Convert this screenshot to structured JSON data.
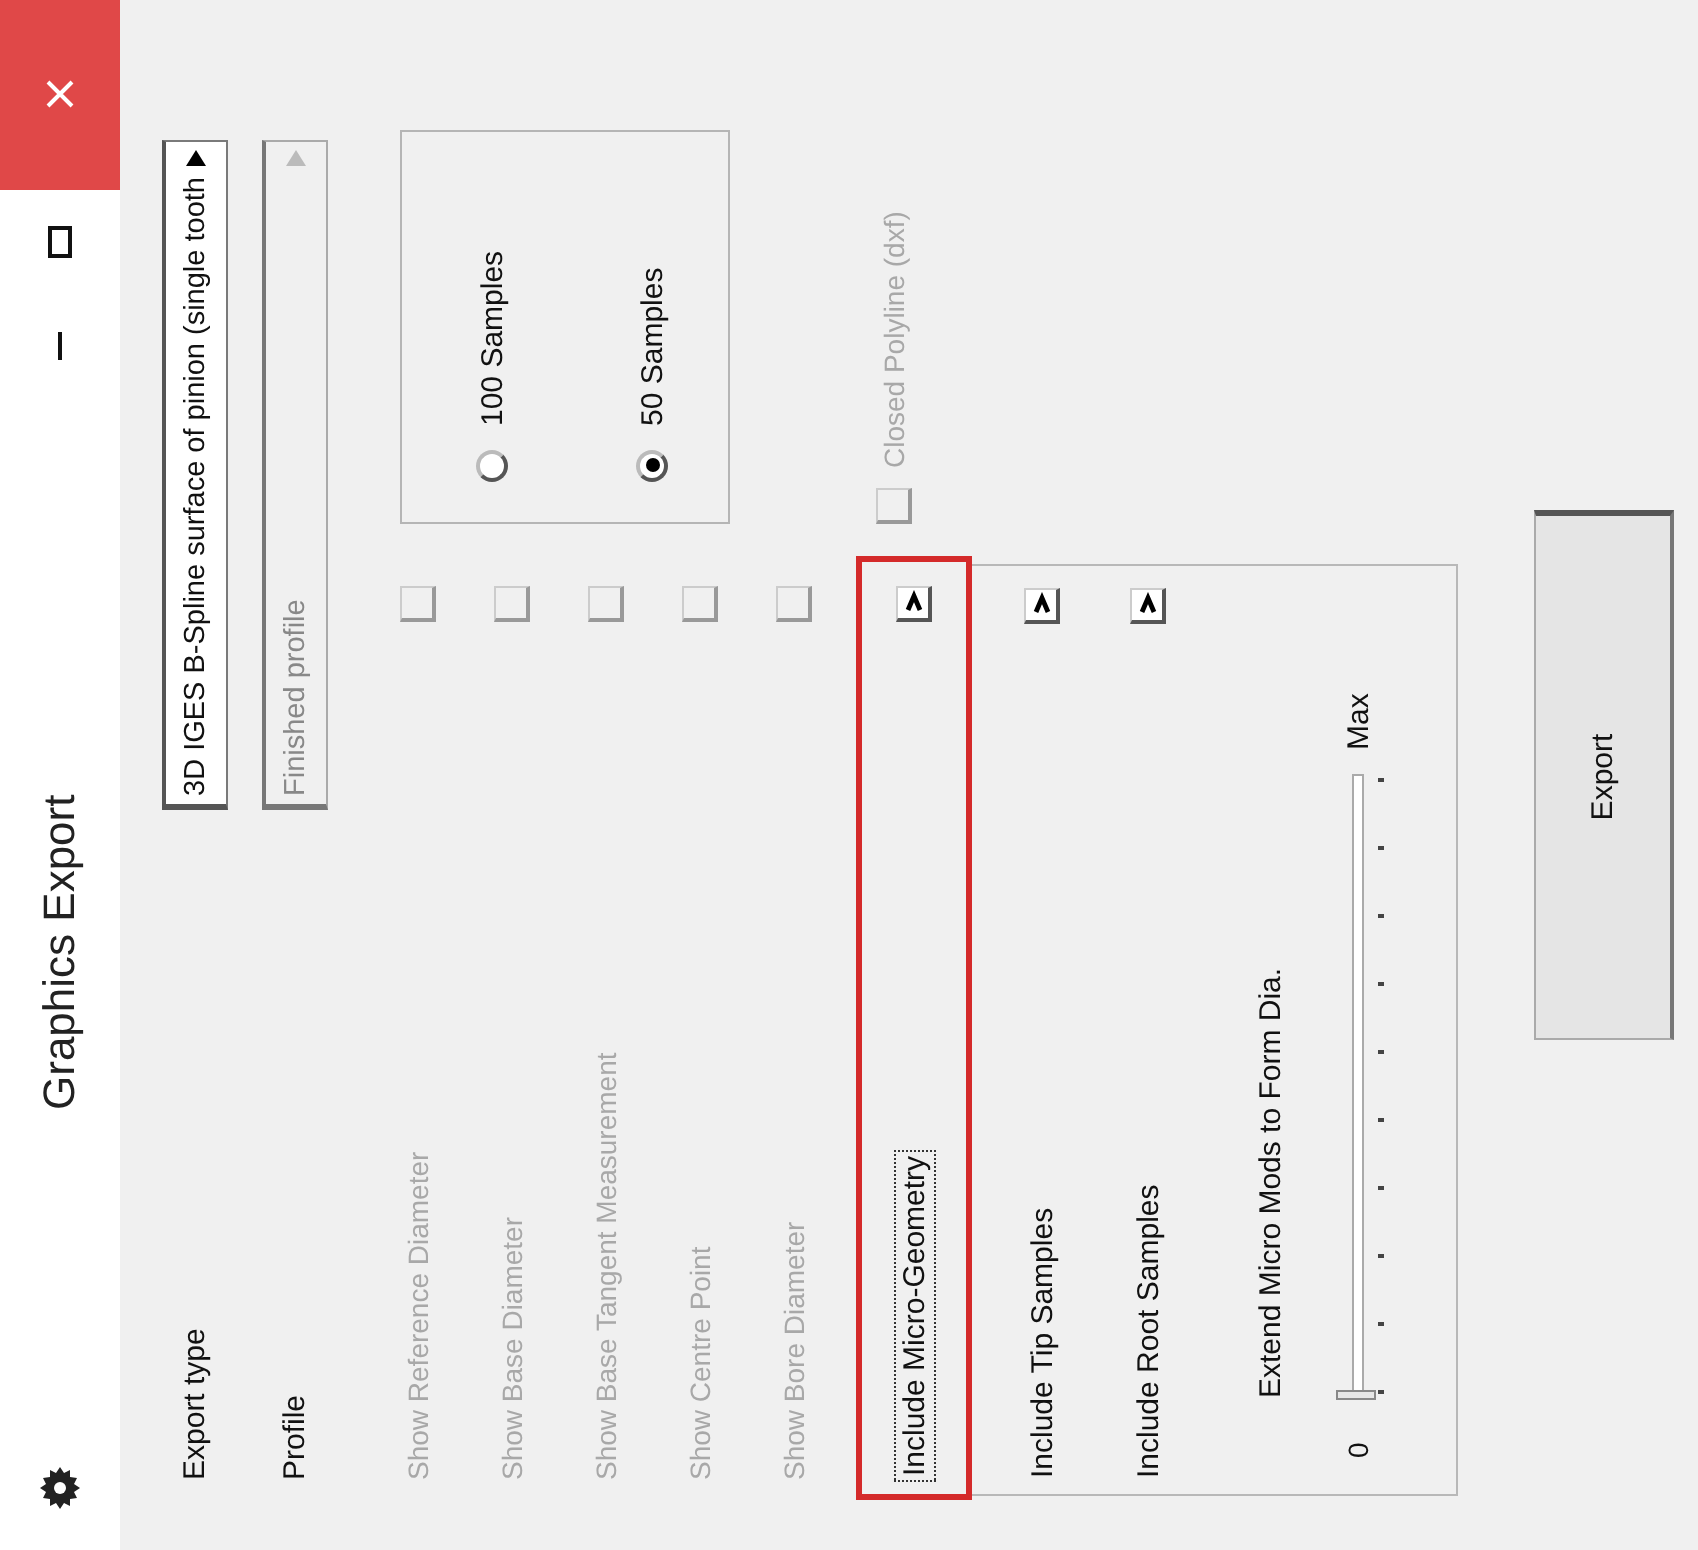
{
  "window": {
    "title": "Graphics Export"
  },
  "export_type": {
    "label": "Export type",
    "value": "3D IGES B-Spline surface of pinion (single tooth"
  },
  "profile": {
    "label": "Profile",
    "value": "Finished profile",
    "disabled": true
  },
  "display_options": [
    {
      "label": "Show Reference Diameter",
      "checked": false,
      "disabled": true
    },
    {
      "label": "Show Base Diameter",
      "checked": false,
      "disabled": true
    },
    {
      "label": "Show Base Tangent Measurement",
      "checked": false,
      "disabled": true
    },
    {
      "label": "Show Centre Point",
      "checked": false,
      "disabled": true
    },
    {
      "label": "Show Bore Diameter",
      "checked": false,
      "disabled": true
    }
  ],
  "samples": [
    {
      "label": "100 Samples",
      "selected": false
    },
    {
      "label": "50 Samples",
      "selected": true
    }
  ],
  "closed_polyline": {
    "label": "Closed Polyline (dxf)",
    "checked": false,
    "disabled": true
  },
  "micro_geometry": {
    "label": "Include Micro-Geometry",
    "checked": true,
    "focused": true,
    "highlighted": true,
    "options": [
      {
        "label": "Include Tip Samples",
        "checked": true
      },
      {
        "label": "Include Root Samples",
        "checked": true
      }
    ],
    "extend": {
      "label": "Extend Micro Mods to Form Dia.",
      "min_label": "0",
      "max_label": "Max",
      "level": 0
    }
  },
  "export_button": "Export"
}
